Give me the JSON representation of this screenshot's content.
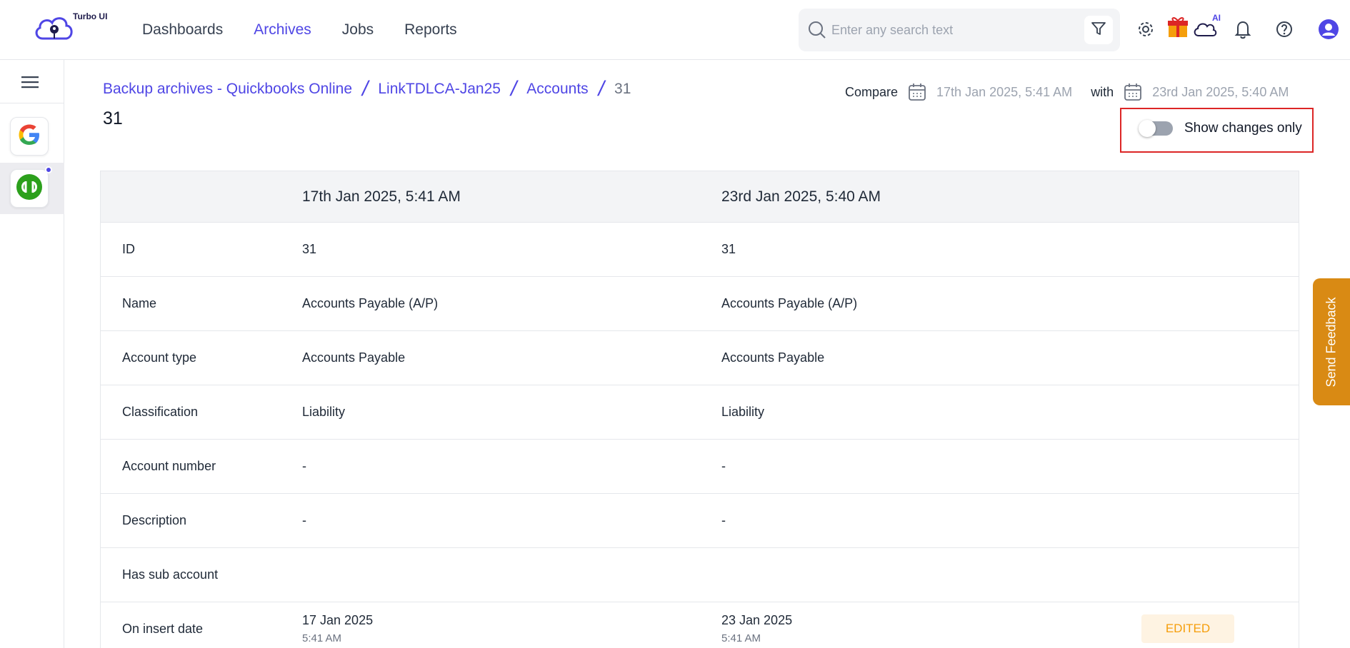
{
  "app": {
    "logo_text": "Turbo UI"
  },
  "nav": {
    "items": [
      "Dashboards",
      "Archives",
      "Jobs",
      "Reports"
    ],
    "active": "Archives"
  },
  "search": {
    "placeholder": "Enter any search text"
  },
  "header_icons": [
    "gear-icon",
    "gift-icon",
    "cloud-ai-icon",
    "bell-icon",
    "help-icon",
    "user-icon"
  ],
  "ai_badge": "AI",
  "sidebar": {
    "apps": [
      "google-app",
      "quickbooks-app"
    ]
  },
  "breadcrumb": {
    "items": [
      "Backup archives - Quickbooks Online",
      "LinkTDLCA-Jan25",
      "Accounts"
    ],
    "current": "31",
    "separator": "/"
  },
  "page_title": "31",
  "compare": {
    "label": "Compare",
    "date_from": "17th Jan 2025, 5:41 AM",
    "with_label": "with",
    "date_to": "23rd Jan 2025, 5:40 AM"
  },
  "toggle": {
    "label": "Show changes only",
    "checked": false
  },
  "table": {
    "headers": [
      "",
      "17th Jan 2025, 5:41 AM",
      "23rd Jan 2025, 5:40 AM"
    ],
    "rows": [
      {
        "label": "ID",
        "v1": "31",
        "v2": "31"
      },
      {
        "label": "Name",
        "v1": "Accounts Payable (A/P)",
        "v2": "Accounts Payable (A/P)"
      },
      {
        "label": "Account type",
        "v1": "Accounts Payable",
        "v2": "Accounts Payable"
      },
      {
        "label": "Classification",
        "v1": "Liability",
        "v2": "Liability"
      },
      {
        "label": "Account number",
        "v1": "-",
        "v2": "-"
      },
      {
        "label": "Description",
        "v1": "-",
        "v2": "-"
      },
      {
        "label": "Has sub account",
        "v1": "",
        "v2": ""
      },
      {
        "label": "On insert date",
        "v1": "17 Jan 2025",
        "v1_sub": "5:41 AM",
        "v2": "23 Jan 2025",
        "v2_sub": "5:41 AM",
        "badge": "EDITED"
      }
    ]
  },
  "feedback": {
    "label": "Send Feedback"
  },
  "colors": {
    "accent": "#4f46e5",
    "feedback": "#d98a14",
    "edited_bg": "#fef3e2",
    "edited_text": "#f59e0b",
    "highlight": "#dc2626"
  }
}
